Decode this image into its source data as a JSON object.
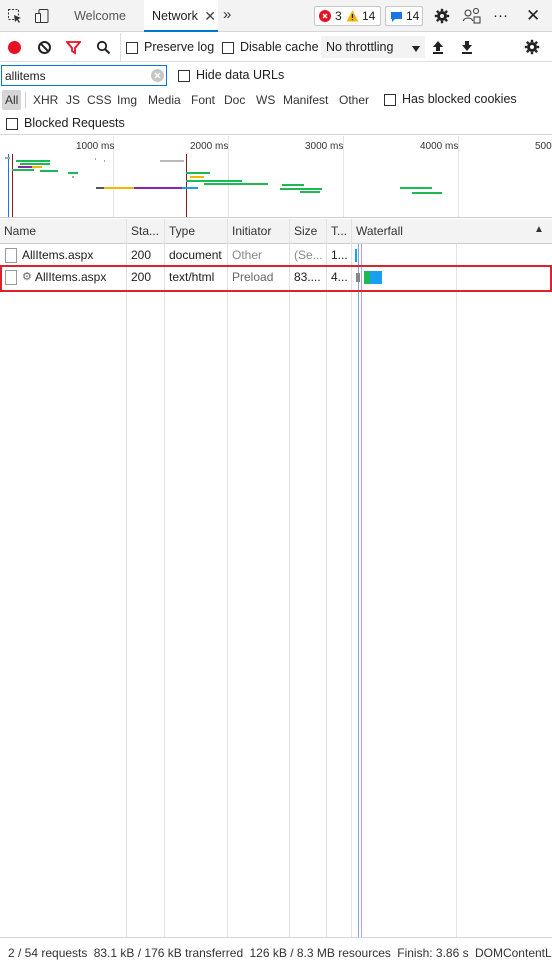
{
  "tabs": {
    "welcome": "Welcome",
    "network": "Network",
    "close_glyph": "✕",
    "more_tabs": "»"
  },
  "badges": {
    "errors": "3",
    "warnings": "14",
    "messages": "14"
  },
  "window": {
    "more_glyph": "···",
    "close_glyph": "✕"
  },
  "toolbar": {
    "preserve_log": "Preserve log",
    "disable_cache": "Disable cache",
    "throttling": "No throttling"
  },
  "filter": {
    "value": "allitems",
    "hide_data_urls": "Hide data URLs"
  },
  "type_filters": [
    "All",
    "XHR",
    "JS",
    "CSS",
    "Img",
    "Media",
    "Font",
    "Doc",
    "WS",
    "Manifest",
    "Other"
  ],
  "has_blocked_cookies": "Has blocked cookies",
  "blocked_requests": "Blocked Requests",
  "overview": {
    "ticks": [
      "1000 ms",
      "2000 ms",
      "3000 ms",
      "4000 ms",
      "500"
    ]
  },
  "columns": {
    "name": "Name",
    "status": "Sta...",
    "type": "Type",
    "initiator": "Initiator",
    "size": "Size",
    "time": "T...",
    "waterfall": "Waterfall",
    "sort_glyph": "▲"
  },
  "rows": [
    {
      "name": "AllItems.aspx",
      "status": "200",
      "type": "document",
      "initiator": "Other",
      "size": "(Se...",
      "time": "1..."
    },
    {
      "preload_glyph": "⚙",
      "name": "AllItems.aspx",
      "status": "200",
      "type": "text/html",
      "initiator": "Preload",
      "size": "83....",
      "time": "4..."
    }
  ],
  "status": {
    "requests": "2 / 54 requests",
    "transferred": "83.1 kB / 176 kB transferred",
    "resources": "126 kB / 8.3 MB resources",
    "finish": "Finish: 3.86 s",
    "dcl": "DOMContentLoa"
  },
  "colors": {
    "accent": "#0078d4",
    "record_red": "#e81123",
    "highlight_red": "#d9232d",
    "waterfall_green": "#1db954",
    "waterfall_blue": "#1a9ff0"
  }
}
